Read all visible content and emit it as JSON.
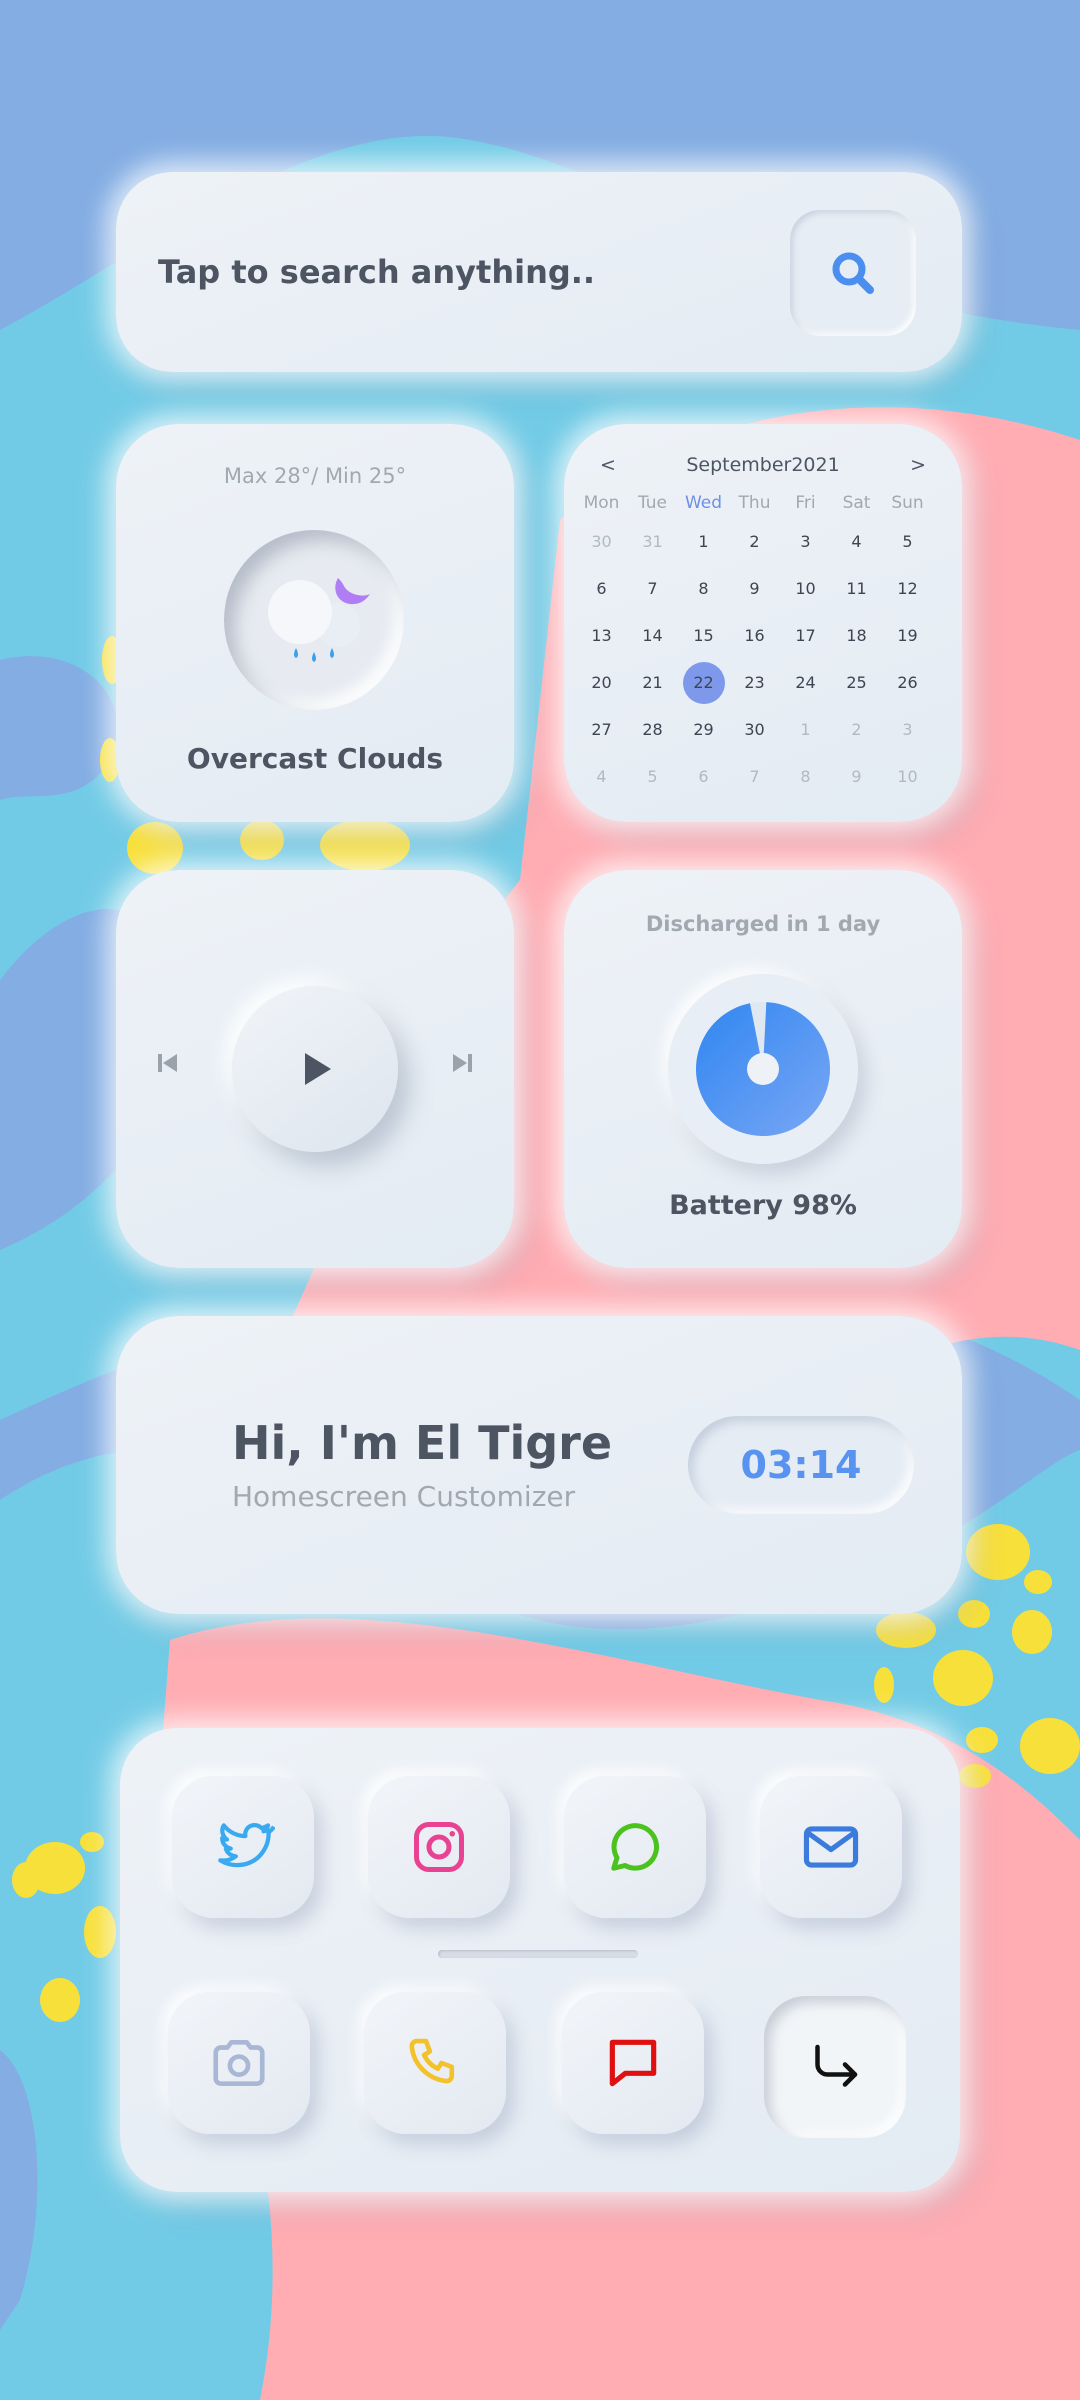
{
  "search": {
    "placeholder": "Tap to search anything..",
    "icon": "search-icon"
  },
  "weather": {
    "max_min": "Max 28°/ Min 25°",
    "condition": "Overcast Clouds",
    "icon": "cloud-moon-rain-icon"
  },
  "calendar": {
    "prev": "<",
    "next": ">",
    "month": "September2021",
    "weekdays": [
      "Mon",
      "Tue",
      "Wed",
      "Thu",
      "Fri",
      "Sat",
      "Sun"
    ],
    "today_weekday": "Wed",
    "selected_day": "22",
    "weeks": [
      [
        {
          "d": "30",
          "o": true
        },
        {
          "d": "31",
          "o": true
        },
        {
          "d": "1"
        },
        {
          "d": "2"
        },
        {
          "d": "3"
        },
        {
          "d": "4"
        },
        {
          "d": "5"
        }
      ],
      [
        {
          "d": "6"
        },
        {
          "d": "7"
        },
        {
          "d": "8"
        },
        {
          "d": "9"
        },
        {
          "d": "10"
        },
        {
          "d": "11"
        },
        {
          "d": "12"
        }
      ],
      [
        {
          "d": "13"
        },
        {
          "d": "14"
        },
        {
          "d": "15"
        },
        {
          "d": "16"
        },
        {
          "d": "17"
        },
        {
          "d": "18"
        },
        {
          "d": "19"
        }
      ],
      [
        {
          "d": "20"
        },
        {
          "d": "21"
        },
        {
          "d": "22"
        },
        {
          "d": "23"
        },
        {
          "d": "24"
        },
        {
          "d": "25"
        },
        {
          "d": "26"
        }
      ],
      [
        {
          "d": "27"
        },
        {
          "d": "28"
        },
        {
          "d": "29"
        },
        {
          "d": "30"
        },
        {
          "d": "1",
          "o": true
        },
        {
          "d": "2",
          "o": true
        },
        {
          "d": "3",
          "o": true
        }
      ],
      [
        {
          "d": "4",
          "o": true
        },
        {
          "d": "5",
          "o": true
        },
        {
          "d": "6",
          "o": true
        },
        {
          "d": "7",
          "o": true
        },
        {
          "d": "8",
          "o": true
        },
        {
          "d": "9",
          "o": true
        },
        {
          "d": "10",
          "o": true
        }
      ]
    ]
  },
  "player": {
    "prev_icon": "skip-previous-icon",
    "play_icon": "play-icon",
    "next_icon": "skip-next-icon"
  },
  "battery": {
    "status": "Discharged in 1 day",
    "label": "Battery 98%",
    "level_percent": 98,
    "color": "#4d8ff2"
  },
  "profile": {
    "name": "Hi, I'm El Tigre",
    "subtitle": "Homescreen Customizer",
    "time": "03:14"
  },
  "dock": {
    "apps": [
      {
        "name": "twitter-icon",
        "color": "#3aaaf0"
      },
      {
        "name": "instagram-icon",
        "color": "#e84393"
      },
      {
        "name": "whatsapp-icon",
        "color": "#4cc21f"
      },
      {
        "name": "mail-icon",
        "color": "#3a7bdc"
      },
      {
        "name": "camera-icon",
        "color": "#a9b7d4"
      },
      {
        "name": "phone-icon",
        "color": "#f3c12a"
      },
      {
        "name": "message-icon",
        "color": "#e01010"
      },
      {
        "name": "reply-arrow-icon",
        "color": "#111111"
      }
    ]
  },
  "colors": {
    "background": "#83ade3",
    "accent": "#5793ef",
    "calendar_selected": "#7e98eb"
  }
}
